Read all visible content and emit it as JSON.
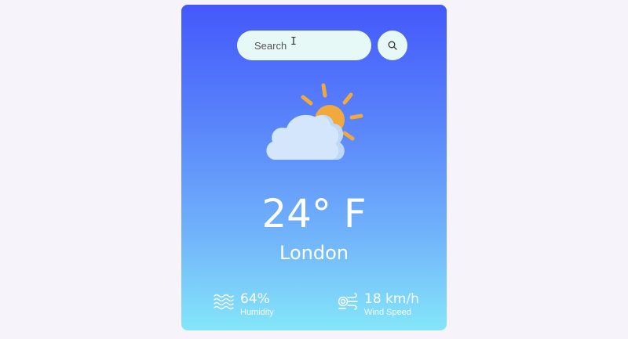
{
  "search": {
    "placeholder": "Search",
    "button_icon": "search-icon"
  },
  "weather": {
    "icon": "partly-cloudy-sun-icon",
    "temperature": "24° F",
    "city": "London"
  },
  "stats": {
    "humidity": {
      "value": "64%",
      "label": "Humidity",
      "icon": "waves-icon"
    },
    "wind": {
      "value": "18 km/h",
      "label": "Wind Speed",
      "icon": "wind-icon"
    }
  },
  "colors": {
    "page_bg": "#f7f3fa",
    "gradient_top": "#4458fb",
    "gradient_bottom": "#84e6f9",
    "search_bg": "#e6f9f6",
    "sun": "#f2a93b",
    "cloud": "#cfe3fa",
    "text": "#ffffff"
  }
}
